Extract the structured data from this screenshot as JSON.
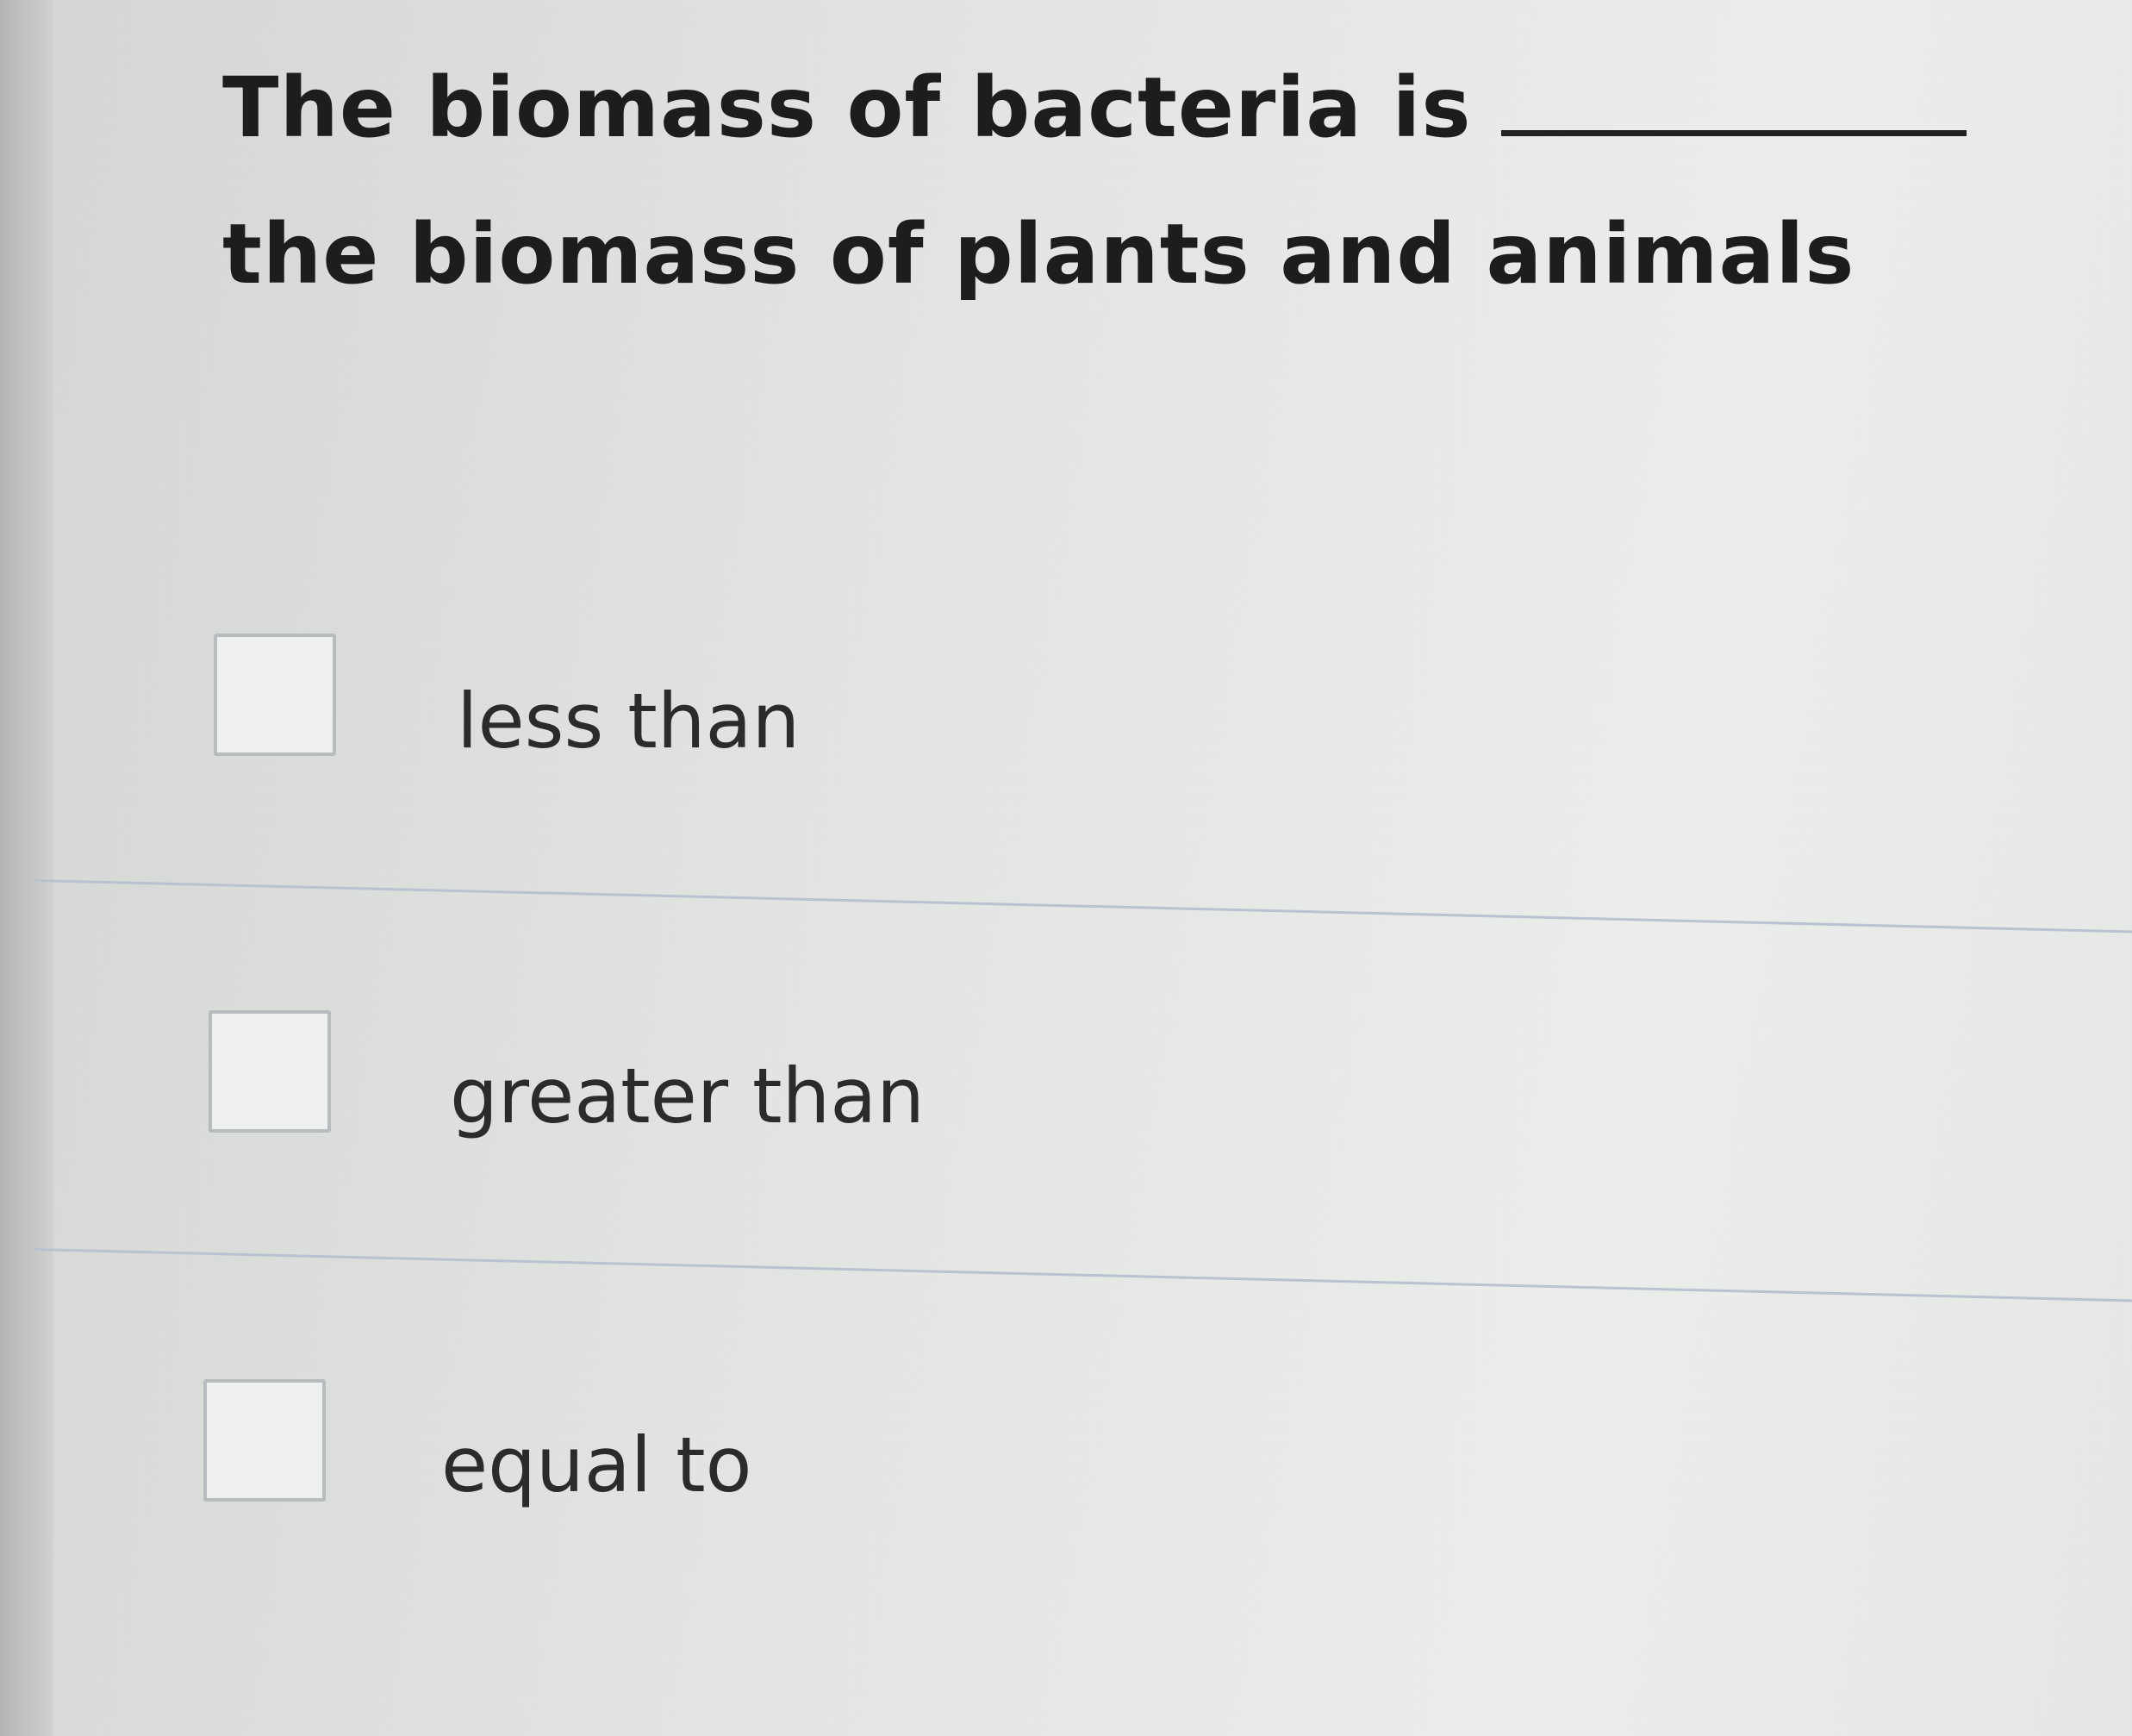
{
  "question": {
    "text_before_blank": "The biomass of bacteria is",
    "text_after_blank": "the biomass of plants and animals"
  },
  "options": [
    {
      "label": "less than",
      "checked": false
    },
    {
      "label": "greater than",
      "checked": false
    },
    {
      "label": "equal to",
      "checked": false
    }
  ]
}
